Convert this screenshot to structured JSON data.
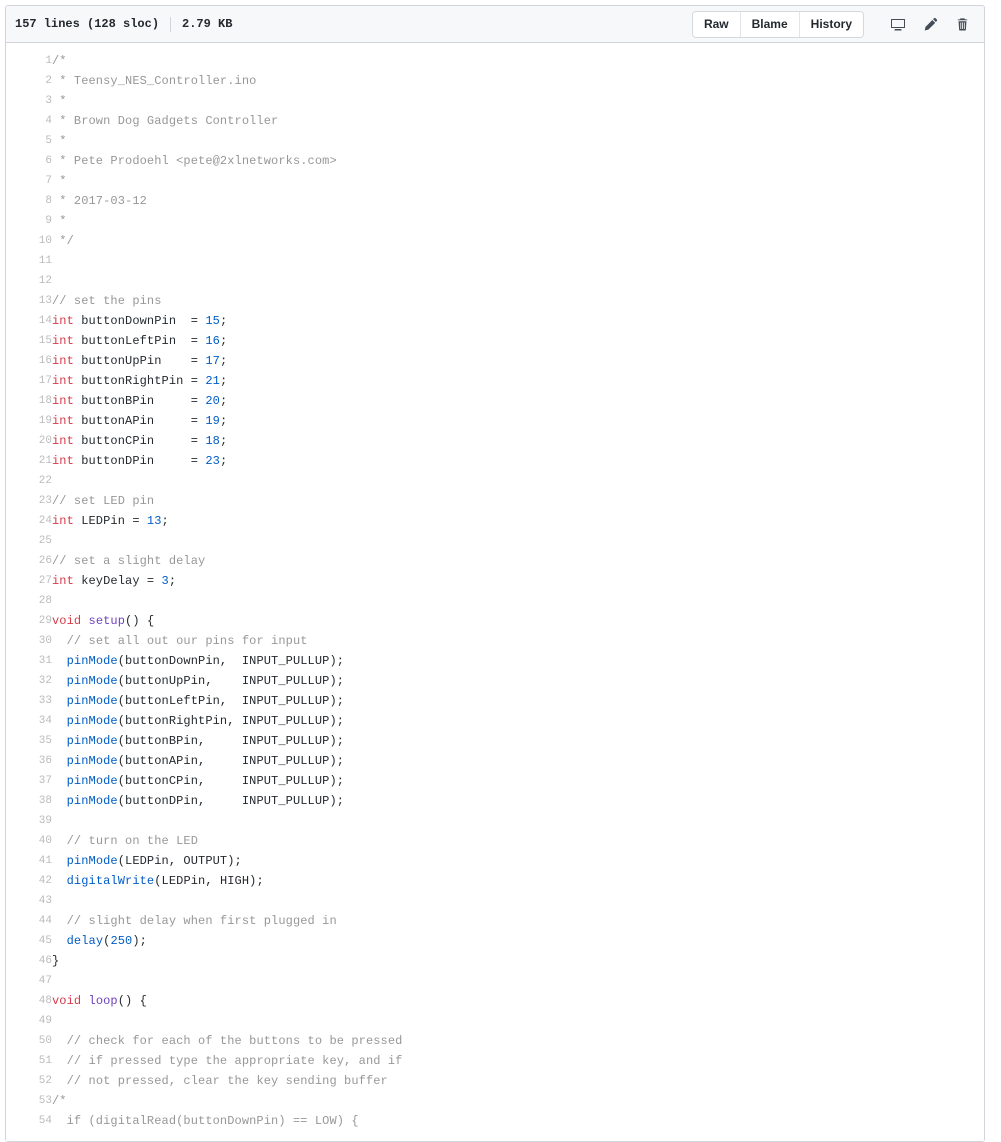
{
  "header": {
    "lines_label": "157 lines (128 sloc)",
    "file_size": "2.79 KB",
    "buttons": [
      {
        "label": "Raw",
        "name": "raw-button"
      },
      {
        "label": "Blame",
        "name": "blame-button"
      },
      {
        "label": "History",
        "name": "history-button"
      }
    ],
    "icons": [
      {
        "name": "desktop-icon",
        "title": "Open this file in GitHub Desktop"
      },
      {
        "name": "pencil-icon",
        "title": "Edit this file"
      },
      {
        "name": "trash-icon",
        "title": "Delete this file"
      }
    ]
  },
  "code": {
    "language": "arduino",
    "start_line": 1,
    "lines": [
      {
        "n": 1,
        "tokens": [
          {
            "t": "c",
            "s": "/*"
          }
        ]
      },
      {
        "n": 2,
        "tokens": [
          {
            "t": "c",
            "s": " * Teensy_NES_Controller.ino"
          }
        ]
      },
      {
        "n": 3,
        "tokens": [
          {
            "t": "c",
            "s": " *"
          }
        ]
      },
      {
        "n": 4,
        "tokens": [
          {
            "t": "c",
            "s": " * Brown Dog Gadgets Controller"
          }
        ]
      },
      {
        "n": 5,
        "tokens": [
          {
            "t": "c",
            "s": " *"
          }
        ]
      },
      {
        "n": 6,
        "tokens": [
          {
            "t": "c",
            "s": " * Pete Prodoehl <pete@2xlnetworks.com>"
          }
        ]
      },
      {
        "n": 7,
        "tokens": [
          {
            "t": "c",
            "s": " *"
          }
        ]
      },
      {
        "n": 8,
        "tokens": [
          {
            "t": "c",
            "s": " * 2017-03-12"
          }
        ]
      },
      {
        "n": 9,
        "tokens": [
          {
            "t": "c",
            "s": " *"
          }
        ]
      },
      {
        "n": 10,
        "tokens": [
          {
            "t": "c",
            "s": " */"
          }
        ]
      },
      {
        "n": 11,
        "tokens": []
      },
      {
        "n": 12,
        "tokens": []
      },
      {
        "n": 13,
        "tokens": [
          {
            "t": "c",
            "s": "// set the pins"
          }
        ]
      },
      {
        "n": 14,
        "tokens": [
          {
            "t": "k",
            "s": "int"
          },
          {
            "t": "p",
            "s": " buttonDownPin  = "
          },
          {
            "t": "n",
            "s": "15"
          },
          {
            "t": "p",
            "s": ";"
          }
        ]
      },
      {
        "n": 15,
        "tokens": [
          {
            "t": "k",
            "s": "int"
          },
          {
            "t": "p",
            "s": " buttonLeftPin  = "
          },
          {
            "t": "n",
            "s": "16"
          },
          {
            "t": "p",
            "s": ";"
          }
        ]
      },
      {
        "n": 16,
        "tokens": [
          {
            "t": "k",
            "s": "int"
          },
          {
            "t": "p",
            "s": " buttonUpPin    = "
          },
          {
            "t": "n",
            "s": "17"
          },
          {
            "t": "p",
            "s": ";"
          }
        ]
      },
      {
        "n": 17,
        "tokens": [
          {
            "t": "k",
            "s": "int"
          },
          {
            "t": "p",
            "s": " buttonRightPin = "
          },
          {
            "t": "n",
            "s": "21"
          },
          {
            "t": "p",
            "s": ";"
          }
        ]
      },
      {
        "n": 18,
        "tokens": [
          {
            "t": "k",
            "s": "int"
          },
          {
            "t": "p",
            "s": " buttonBPin     = "
          },
          {
            "t": "n",
            "s": "20"
          },
          {
            "t": "p",
            "s": ";"
          }
        ]
      },
      {
        "n": 19,
        "tokens": [
          {
            "t": "k",
            "s": "int"
          },
          {
            "t": "p",
            "s": " buttonAPin     = "
          },
          {
            "t": "n",
            "s": "19"
          },
          {
            "t": "p",
            "s": ";"
          }
        ]
      },
      {
        "n": 20,
        "tokens": [
          {
            "t": "k",
            "s": "int"
          },
          {
            "t": "p",
            "s": " buttonCPin     = "
          },
          {
            "t": "n",
            "s": "18"
          },
          {
            "t": "p",
            "s": ";"
          }
        ]
      },
      {
        "n": 21,
        "tokens": [
          {
            "t": "k",
            "s": "int"
          },
          {
            "t": "p",
            "s": " buttonDPin     = "
          },
          {
            "t": "n",
            "s": "23"
          },
          {
            "t": "p",
            "s": ";"
          }
        ]
      },
      {
        "n": 22,
        "tokens": []
      },
      {
        "n": 23,
        "tokens": [
          {
            "t": "c",
            "s": "// set LED pin"
          }
        ]
      },
      {
        "n": 24,
        "tokens": [
          {
            "t": "k",
            "s": "int"
          },
          {
            "t": "p",
            "s": " LEDPin = "
          },
          {
            "t": "n",
            "s": "13"
          },
          {
            "t": "p",
            "s": ";"
          }
        ]
      },
      {
        "n": 25,
        "tokens": []
      },
      {
        "n": 26,
        "tokens": [
          {
            "t": "c",
            "s": "// set a slight delay"
          }
        ]
      },
      {
        "n": 27,
        "tokens": [
          {
            "t": "k",
            "s": "int"
          },
          {
            "t": "p",
            "s": " keyDelay = "
          },
          {
            "t": "n",
            "s": "3"
          },
          {
            "t": "p",
            "s": ";"
          }
        ]
      },
      {
        "n": 28,
        "tokens": []
      },
      {
        "n": 29,
        "tokens": [
          {
            "t": "k",
            "s": "void"
          },
          {
            "t": "p",
            "s": " "
          },
          {
            "t": "e",
            "s": "setup"
          },
          {
            "t": "p",
            "s": "() {"
          }
        ]
      },
      {
        "n": 30,
        "tokens": [
          {
            "t": "p",
            "s": "  "
          },
          {
            "t": "c",
            "s": "// set all out our pins for input"
          }
        ]
      },
      {
        "n": 31,
        "tokens": [
          {
            "t": "p",
            "s": "  "
          },
          {
            "t": "f",
            "s": "pinMode"
          },
          {
            "t": "p",
            "s": "(buttonDownPin,  INPUT_PULLUP);"
          }
        ]
      },
      {
        "n": 32,
        "tokens": [
          {
            "t": "p",
            "s": "  "
          },
          {
            "t": "f",
            "s": "pinMode"
          },
          {
            "t": "p",
            "s": "(buttonUpPin,    INPUT_PULLUP);"
          }
        ]
      },
      {
        "n": 33,
        "tokens": [
          {
            "t": "p",
            "s": "  "
          },
          {
            "t": "f",
            "s": "pinMode"
          },
          {
            "t": "p",
            "s": "(buttonLeftPin,  INPUT_PULLUP);"
          }
        ]
      },
      {
        "n": 34,
        "tokens": [
          {
            "t": "p",
            "s": "  "
          },
          {
            "t": "f",
            "s": "pinMode"
          },
          {
            "t": "p",
            "s": "(buttonRightPin, INPUT_PULLUP);"
          }
        ]
      },
      {
        "n": 35,
        "tokens": [
          {
            "t": "p",
            "s": "  "
          },
          {
            "t": "f",
            "s": "pinMode"
          },
          {
            "t": "p",
            "s": "(buttonBPin,     INPUT_PULLUP);"
          }
        ]
      },
      {
        "n": 36,
        "tokens": [
          {
            "t": "p",
            "s": "  "
          },
          {
            "t": "f",
            "s": "pinMode"
          },
          {
            "t": "p",
            "s": "(buttonAPin,     INPUT_PULLUP);"
          }
        ]
      },
      {
        "n": 37,
        "tokens": [
          {
            "t": "p",
            "s": "  "
          },
          {
            "t": "f",
            "s": "pinMode"
          },
          {
            "t": "p",
            "s": "(buttonCPin,     INPUT_PULLUP);"
          }
        ]
      },
      {
        "n": 38,
        "tokens": [
          {
            "t": "p",
            "s": "  "
          },
          {
            "t": "f",
            "s": "pinMode"
          },
          {
            "t": "p",
            "s": "(buttonDPin,     INPUT_PULLUP);"
          }
        ]
      },
      {
        "n": 39,
        "tokens": []
      },
      {
        "n": 40,
        "tokens": [
          {
            "t": "p",
            "s": "  "
          },
          {
            "t": "c",
            "s": "// turn on the LED"
          }
        ]
      },
      {
        "n": 41,
        "tokens": [
          {
            "t": "p",
            "s": "  "
          },
          {
            "t": "f",
            "s": "pinMode"
          },
          {
            "t": "p",
            "s": "(LEDPin, OUTPUT);"
          }
        ]
      },
      {
        "n": 42,
        "tokens": [
          {
            "t": "p",
            "s": "  "
          },
          {
            "t": "f",
            "s": "digitalWrite"
          },
          {
            "t": "p",
            "s": "(LEDPin, HIGH);"
          }
        ]
      },
      {
        "n": 43,
        "tokens": []
      },
      {
        "n": 44,
        "tokens": [
          {
            "t": "p",
            "s": "  "
          },
          {
            "t": "c",
            "s": "// slight delay when first plugged in"
          }
        ]
      },
      {
        "n": 45,
        "tokens": [
          {
            "t": "p",
            "s": "  "
          },
          {
            "t": "f",
            "s": "delay"
          },
          {
            "t": "p",
            "s": "("
          },
          {
            "t": "n",
            "s": "250"
          },
          {
            "t": "p",
            "s": ");"
          }
        ]
      },
      {
        "n": 46,
        "tokens": [
          {
            "t": "p",
            "s": "}"
          }
        ]
      },
      {
        "n": 47,
        "tokens": []
      },
      {
        "n": 48,
        "tokens": [
          {
            "t": "k",
            "s": "void"
          },
          {
            "t": "p",
            "s": " "
          },
          {
            "t": "e",
            "s": "loop"
          },
          {
            "t": "p",
            "s": "() {"
          }
        ]
      },
      {
        "n": 49,
        "tokens": []
      },
      {
        "n": 50,
        "tokens": [
          {
            "t": "p",
            "s": "  "
          },
          {
            "t": "c",
            "s": "// check for each of the buttons to be pressed"
          }
        ]
      },
      {
        "n": 51,
        "tokens": [
          {
            "t": "p",
            "s": "  "
          },
          {
            "t": "c",
            "s": "// if pressed type the appropriate key, and if"
          }
        ]
      },
      {
        "n": 52,
        "tokens": [
          {
            "t": "p",
            "s": "  "
          },
          {
            "t": "c",
            "s": "// not pressed, clear the key sending buffer"
          }
        ]
      },
      {
        "n": 53,
        "tokens": [
          {
            "t": "c",
            "s": "/*"
          }
        ]
      },
      {
        "n": 54,
        "tokens": [
          {
            "t": "c",
            "s": "  if (digitalRead(buttonDownPin) == LOW) {"
          }
        ]
      }
    ]
  },
  "colors": {
    "comment": "#969896",
    "keyword": "#d73a49",
    "number": "#005cc5",
    "function": "#005cc5",
    "entity": "#6f42c1",
    "plain": "#24292e",
    "line_number": "#babbbd",
    "header_bg": "#f6f8fa",
    "border": "#d1d5da"
  }
}
